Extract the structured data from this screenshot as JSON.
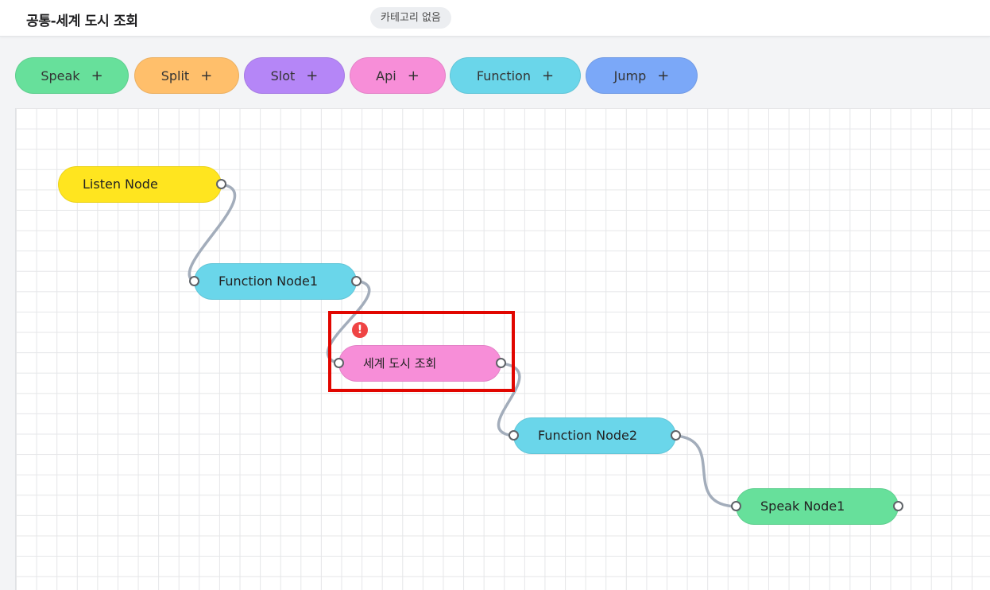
{
  "header": {
    "title": "공통-세계 도시 조회",
    "category": "카테고리 없음"
  },
  "toolbar": {
    "buttons": [
      {
        "label": "Speak",
        "plus": "+",
        "color": "#67e09b"
      },
      {
        "label": "Split",
        "plus": "+",
        "color": "#ffbf6b"
      },
      {
        "label": "Slot",
        "plus": "+",
        "color": "#b586f7"
      },
      {
        "label": "Api",
        "plus": "+",
        "color": "#f78ed8"
      },
      {
        "label": "Function",
        "plus": "+",
        "color": "#6ad6ea"
      },
      {
        "label": "Jump",
        "plus": "+",
        "color": "#7ba8f8"
      }
    ]
  },
  "nodes": [
    {
      "label": "Listen Node",
      "type": "listen",
      "color": "#ffe51f"
    },
    {
      "label": "Function Node1",
      "type": "function",
      "color": "#6ad6ea"
    },
    {
      "label": "세계 도시 조회",
      "type": "api",
      "color": "#f78ed8",
      "warning": "!"
    },
    {
      "label": "Function Node2",
      "type": "function",
      "color": "#6ad6ea"
    },
    {
      "label": "Speak Node1",
      "type": "speak",
      "color": "#67e09b"
    }
  ],
  "colors": {
    "edge": "#a3adbb",
    "highlight": "#e10600",
    "warning": "#ef4444"
  }
}
